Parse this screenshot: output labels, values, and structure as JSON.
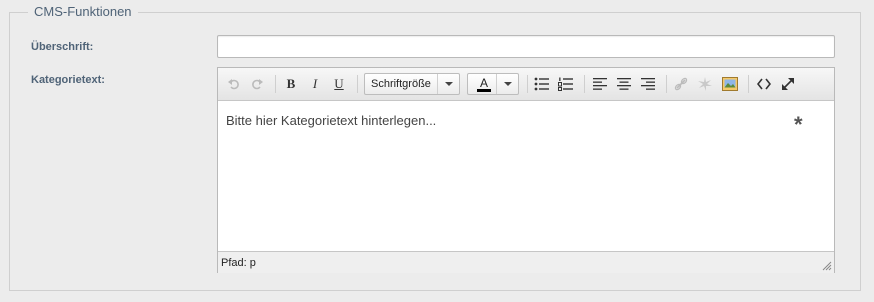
{
  "fieldset": {
    "legend": "CMS-Funktionen"
  },
  "form": {
    "heading_label": "Überschrift:",
    "heading_value": "",
    "category_label": "Kategorietext:"
  },
  "editor": {
    "toolbar": {
      "undo_icon": "undo-icon",
      "redo_icon": "redo-icon",
      "bold": "B",
      "italic": "I",
      "underline": "U",
      "fontsize_value": "Schriftgröße",
      "textcolor_letter": "A",
      "textcolor": "#000000"
    },
    "content_text": "Bitte hier Kategorietext hinterlegen...",
    "required_mark": "*",
    "status_path": "Pfad: p"
  },
  "colors": {
    "label": "#4f6377",
    "background": "#ececec"
  }
}
